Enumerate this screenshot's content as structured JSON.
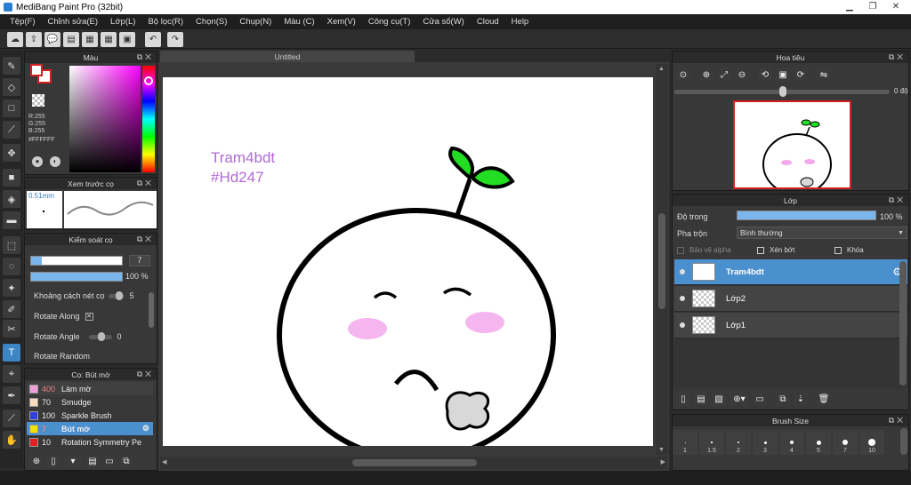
{
  "title": "MediBang Paint Pro (32bit)",
  "menu": [
    "Tệp(F)",
    "Chỉnh sửa(E)",
    "Lớp(L)",
    "Bộ lọc(R)",
    "Chọn(S)",
    "Chụp(N)",
    "Màu (C)",
    "Xem(V)",
    "Công cụ(T)",
    "Cửa sổ(W)",
    "Cloud",
    "Help"
  ],
  "document": {
    "tab": "Untitled",
    "text_line1": "Tram4bdt",
    "text_line2": "#Hd247",
    "text_color": "#b06ad6"
  },
  "color_panel": {
    "title": "Màu",
    "r": "R:255",
    "g": "G:255",
    "b": "B:255",
    "hex": "#FFFFFF",
    "foreground": "#d22020",
    "background": "#ffffff"
  },
  "brush_preview": {
    "title": "Xem trước cọ",
    "size": "0.51mm"
  },
  "brush_control": {
    "title": "Kiểm soát cọ",
    "size_value": "7",
    "opacity_value": "100 %",
    "spacing_label": "Khoảng cách nét cọ",
    "spacing_value": "5",
    "rotate_along_label": "Rotate Along",
    "rotate_along_mark": "✕",
    "rotate_angle_label": "Rotate Angle",
    "rotate_angle_value": "0",
    "rotate_random_label": "Rotate Random"
  },
  "brush_list": {
    "title": "Cọ: Bút mờ",
    "items": [
      {
        "size": "400",
        "name": "Làm mờ",
        "color": "#f0a0d8"
      },
      {
        "size": "70",
        "name": "Smudge",
        "color": "#f5dcc0"
      },
      {
        "size": "100",
        "name": "Sparkle Brush",
        "color": "#3040e0"
      },
      {
        "size": "7",
        "name": "Bút mờ",
        "color": "#f0e000"
      },
      {
        "size": "10",
        "name": "Rotation Symmetry Pe",
        "color": "#e02020"
      }
    ]
  },
  "navigator": {
    "title": "Hoa tiêu",
    "angle": "0 độ"
  },
  "layer_panel": {
    "title": "Lớp",
    "opacity_label": "Độ trong",
    "opacity_value": "100 %",
    "opacity_level": 1.0,
    "blend_label": "Pha trộn",
    "blend_value": "Bình thường",
    "protect_alpha": "Bảo vệ alpha",
    "clipping": "Xén bớt",
    "lock": "Khóa",
    "layers": [
      {
        "name": "Tram4bdt",
        "selected": true
      },
      {
        "name": "Lớp2",
        "selected": false
      },
      {
        "name": "Lớp1",
        "selected": false
      }
    ]
  },
  "brush_size": {
    "title": "Brush Size",
    "sizes": [
      "1",
      "1.5",
      "2",
      "3",
      "4",
      "5",
      "7",
      "10"
    ]
  }
}
